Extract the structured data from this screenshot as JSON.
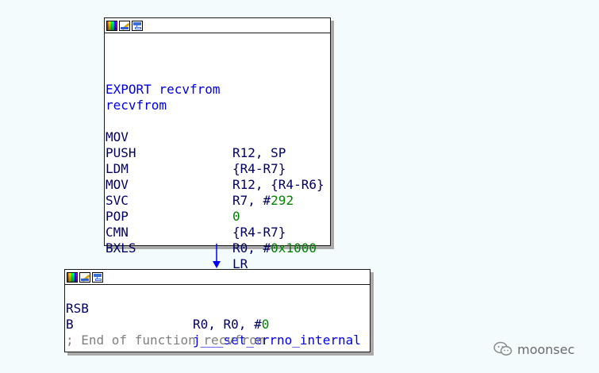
{
  "block1": {
    "icons": [
      "color-palette-icon",
      "edit-pencil-icon",
      "graph-view-icon"
    ],
    "label_export": "EXPORT recvfrom",
    "label_func": "recvfrom",
    "lines": [
      {
        "mnemonic": "MOV",
        "op_a": "R12, SP",
        "op_b": "",
        "op_c": ""
      },
      {
        "mnemonic": "PUSH",
        "op_a": "{R4-R7}",
        "op_b": "",
        "op_c": ""
      },
      {
        "mnemonic": "LDM",
        "op_a": "R12, {R4-R6}",
        "op_b": "",
        "op_c": ""
      },
      {
        "mnemonic": "MOV",
        "op_a": "R7, #",
        "op_b": "292",
        "op_c": ""
      },
      {
        "mnemonic": "SVC",
        "op_a": "",
        "op_b": "0",
        "op_c": ""
      },
      {
        "mnemonic": "POP",
        "op_a": "{R4-R7}",
        "op_b": "",
        "op_c": ""
      },
      {
        "mnemonic": "CMN",
        "op_a": "R0, #",
        "op_b": "0x1000",
        "op_c": ""
      },
      {
        "mnemonic": "BXLS",
        "op_a": "LR",
        "op_b": "",
        "op_c": ""
      }
    ]
  },
  "block2": {
    "icons": [
      "color-palette-icon",
      "edit-pencil-icon",
      "graph-view-icon"
    ],
    "lines": [
      {
        "mnemonic": "RSB",
        "op_a": "R0, R0, #",
        "op_b": "0"
      },
      {
        "mnemonic": "B",
        "op_sym": "j___set_errno_internal"
      }
    ],
    "comment": "; End of function recvfrom"
  },
  "edge": {
    "color": "#0000ff"
  },
  "watermark": {
    "text": "moonsec"
  }
}
